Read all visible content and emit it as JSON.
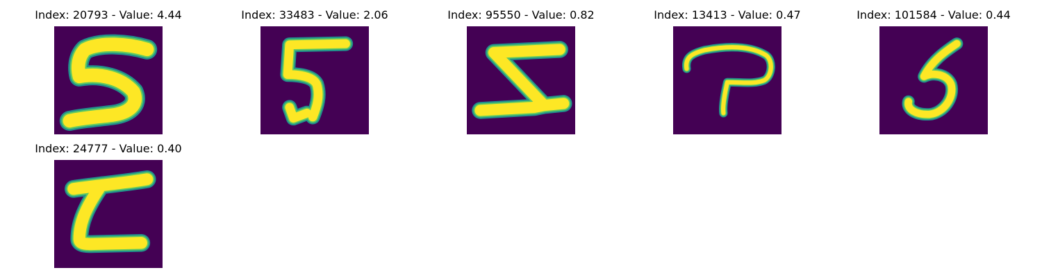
{
  "figure": {
    "panels": [
      {
        "index": "20793",
        "value": "4.44",
        "title": "Index: 20793 - Value: 4.44",
        "glyph": "5"
      },
      {
        "index": "33483",
        "value": "2.06",
        "title": "Index: 33483 - Value: 2.06",
        "glyph": "5"
      },
      {
        "index": "95550",
        "value": "0.82",
        "title": "Index: 95550 - Value: 0.82",
        "glyph": "Z"
      },
      {
        "index": "13413",
        "value": "0.47",
        "title": "Index: 13413 - Value: 0.47",
        "glyph": "P"
      },
      {
        "index": "101584",
        "value": "0.44",
        "title": "Index: 101584 - Value: 0.44",
        "glyph": "5"
      },
      {
        "index": "24777",
        "value": "0.40",
        "title": "Index: 24777 - Value: 0.40",
        "glyph": "Z"
      }
    ],
    "colors": {
      "background": "#440154",
      "stroke_outer": "#21918c",
      "stroke_mid": "#5ec962",
      "stroke_inner": "#fde725"
    }
  }
}
